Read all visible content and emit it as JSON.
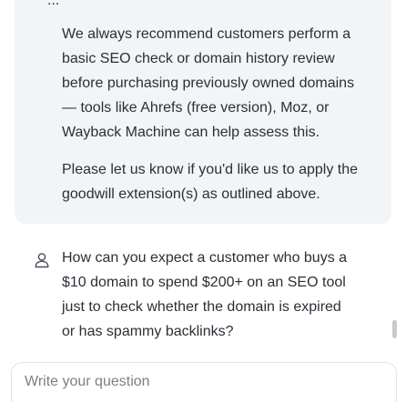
{
  "assistant": {
    "cut_off_text": "...",
    "paragraph_1": "We always recommend customers perform a\nbasic SEO check or domain history review\nbefore purchasing previously owned domains\n— tools like Ahrefs (free version), Moz, or\nWayback Machine can help assess this.",
    "paragraph_2": "Please let us know if you'd like us to apply the\ngoodwill extension(s) as outlined above."
  },
  "user": {
    "message": "How can you expect a customer who buys a\n$10 domain to spend $200+ on an SEO tool\njust to check whether the domain is expired\nor has spammy backlinks?",
    "icon": "user-icon"
  },
  "composer": {
    "placeholder": "Write your question"
  },
  "colors": {
    "bubble_bg": "#f3f4f6",
    "text": "#2b2f36",
    "placeholder": "#7a7f88",
    "border": "#e1e3e7"
  }
}
